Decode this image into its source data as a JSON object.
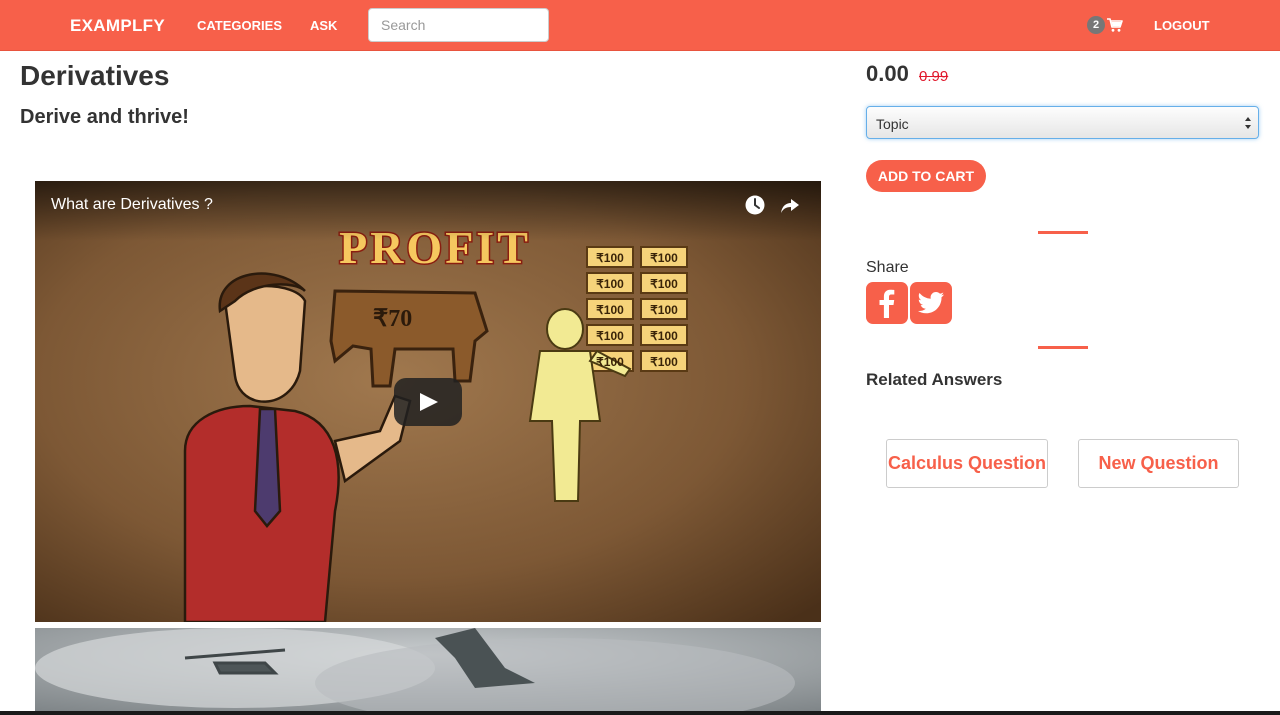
{
  "navbar": {
    "brand": "EXAMPLFY",
    "categories": "CATEGORIES",
    "ask": "ASK",
    "search_placeholder": "Search",
    "cart_count": "2",
    "logout": "LOGOUT"
  },
  "product": {
    "title": "Derivatives",
    "subtitle": "Derive and thrive!",
    "price": "0.00",
    "old_price": "0.99",
    "topic_selected": "Topic",
    "add_to_cart": "ADD TO CART"
  },
  "video": {
    "title": "What are Derivatives ?",
    "scene_text": "PROFIT",
    "cow_price": "₹70",
    "note_value": "₹100"
  },
  "share": {
    "label": "Share"
  },
  "related": {
    "label": "Related Answers",
    "items": [
      "Calculus Question",
      "New Question"
    ]
  },
  "colors": {
    "accent": "#f7604a",
    "old_price": "#e0182b",
    "link_focus": "#66afe9"
  }
}
